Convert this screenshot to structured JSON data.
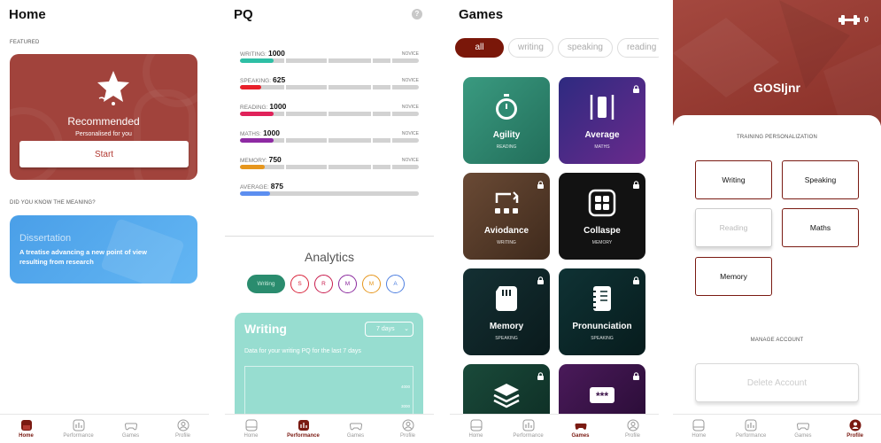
{
  "nav": [
    {
      "label": "Home",
      "icon": "home-icon"
    },
    {
      "label": "Performance",
      "icon": "performance-icon"
    },
    {
      "label": "Games",
      "icon": "gamepad-icon"
    },
    {
      "label": "Profile",
      "icon": "profile-icon"
    }
  ],
  "home": {
    "title": "Home",
    "featured_label": "FEATURED",
    "featured": {
      "title": "Recommended",
      "subtitle": "Personalised for you",
      "button": "Start"
    },
    "dictionary_label": "DID YOU KNOW THE MEANING?",
    "dictionary": {
      "word": "Dissertation",
      "definition": "A treatise advancing a new point of view resulting from research"
    }
  },
  "pq": {
    "title": "PQ",
    "help": "?",
    "rows": [
      {
        "label": "WRITING:",
        "value": "1000",
        "level": "NOVICE",
        "fill": 0.19,
        "color": "#2ebfa5"
      },
      {
        "label": "SPEAKING:",
        "value": "625",
        "level": "NOVICE",
        "fill": 0.12,
        "color": "#e8202a"
      },
      {
        "label": "READING:",
        "value": "1000",
        "level": "NOVICE",
        "fill": 0.19,
        "color": "#e0225a"
      },
      {
        "label": "MATHS:",
        "value": "1000",
        "level": "NOVICE",
        "fill": 0.19,
        "color": "#8e2aa3"
      },
      {
        "label": "MEMORY:",
        "value": "750",
        "level": "NOVICE",
        "fill": 0.14,
        "color": "#e6961d"
      },
      {
        "label": "AVERAGE:",
        "value": "875",
        "level": "",
        "fill": 0.17,
        "color": "#5c8ef0"
      }
    ],
    "analytics_title": "Analytics",
    "chips": [
      {
        "label": "Writing",
        "color": "#2a8c6e"
      },
      {
        "label": "S",
        "color": "#d8233a"
      },
      {
        "label": "R",
        "color": "#c81b4d"
      },
      {
        "label": "M",
        "color": "#8b2a9e"
      },
      {
        "label": "M",
        "color": "#e6961d"
      },
      {
        "label": "A",
        "color": "#4e7fe0"
      }
    ],
    "chart_card": {
      "title": "Writing",
      "range": "7 days",
      "description": "Data for your writing PQ for the last 7 days",
      "y_ticks": [
        "4000",
        "3000"
      ]
    }
  },
  "games": {
    "title": "Games",
    "filters": [
      "all",
      "writing",
      "speaking",
      "reading"
    ],
    "cards": [
      {
        "name": "Agility",
        "skill": "READING",
        "locked": false,
        "icon": "stopwatch-icon",
        "bg": "#2f8a72"
      },
      {
        "name": "Average",
        "skill": "MATHS",
        "locked": true,
        "icon": "bracket-bar-icon",
        "bg": "#3a2a7c"
      },
      {
        "name": "Aviodance",
        "skill": "WRITING",
        "locked": true,
        "icon": "dots-arrow-icon",
        "bg": "#5a3a28"
      },
      {
        "name": "Collaspe",
        "skill": "MEMORY",
        "locked": true,
        "icon": "grid-icon",
        "bg": "#121212"
      },
      {
        "name": "Memory",
        "skill": "SPEAKING",
        "locked": true,
        "icon": "sd-card-icon",
        "bg": "#0f2326"
      },
      {
        "name": "Pronunciation",
        "skill": "SPEAKING",
        "locked": true,
        "icon": "notebook-icon",
        "bg": "#0c2a2b"
      },
      {
        "name": "",
        "skill": "",
        "locked": true,
        "icon": "layers-icon",
        "bg": "#123a30"
      },
      {
        "name": "",
        "skill": "",
        "locked": true,
        "icon": "password-icon",
        "bg": "#3a1248"
      }
    ]
  },
  "profile": {
    "score": "0",
    "username": "GOSIjnr",
    "personalization_label": "TRAINING PERSONALIZATION",
    "options": [
      {
        "label": "Writing",
        "state": "on"
      },
      {
        "label": "Speaking",
        "state": "on"
      },
      {
        "label": "Reading",
        "state": "disabled"
      },
      {
        "label": "Maths",
        "state": "on"
      },
      {
        "label": "Memory",
        "state": "on"
      }
    ],
    "manage_label": "MANAGE ACCOUNT",
    "delete_button": "Delete Account"
  }
}
